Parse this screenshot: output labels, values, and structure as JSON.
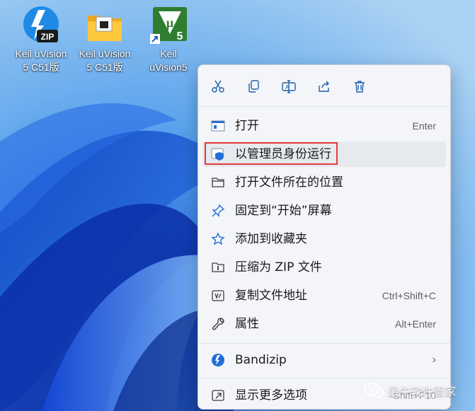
{
  "desktop": {
    "icons": [
      {
        "label": "Keil uVision\n5 C51版",
        "icon": "bandizip-zip-icon"
      },
      {
        "label": "Keil uVision\n5 C51版",
        "icon": "folder-icon"
      },
      {
        "label": "Keil\nuVision5",
        "icon": "keil-uvision-shortcut-icon"
      }
    ]
  },
  "menu": {
    "toolbar": [
      "cut-icon",
      "copy-icon",
      "rename-icon",
      "share-icon",
      "delete-icon"
    ],
    "items": [
      {
        "label": "打开",
        "shortcut": "Enter",
        "icon": "open-window-icon"
      },
      {
        "label": "以管理员身份运行",
        "shortcut": "",
        "icon": "shield-icon"
      },
      {
        "label": "打开文件所在的位置",
        "shortcut": "",
        "icon": "folder-icon"
      },
      {
        "label": "固定到“开始”屏幕",
        "shortcut": "",
        "icon": "pin-icon"
      },
      {
        "label": "添加到收藏夹",
        "shortcut": "",
        "icon": "star-icon"
      },
      {
        "label": "压缩为 ZIP 文件",
        "shortcut": "",
        "icon": "zip-folder-icon"
      },
      {
        "label": "复制文件地址",
        "shortcut": "Ctrl+Shift+C",
        "icon": "copy-path-icon"
      },
      {
        "label": "属性",
        "shortcut": "Alt+Enter",
        "icon": "wrench-icon"
      },
      {
        "label": "Bandizip",
        "shortcut": "",
        "icon": "bandizip-icon"
      },
      {
        "label": "显示更多选项",
        "shortcut": "Shift+F10",
        "icon": "more-options-icon"
      }
    ]
  },
  "watermark": {
    "text": "最牛软件管家",
    "icon": "wechat-icon"
  },
  "colors": {
    "highlight": "#e33b3b",
    "accent": "#0067c0"
  }
}
